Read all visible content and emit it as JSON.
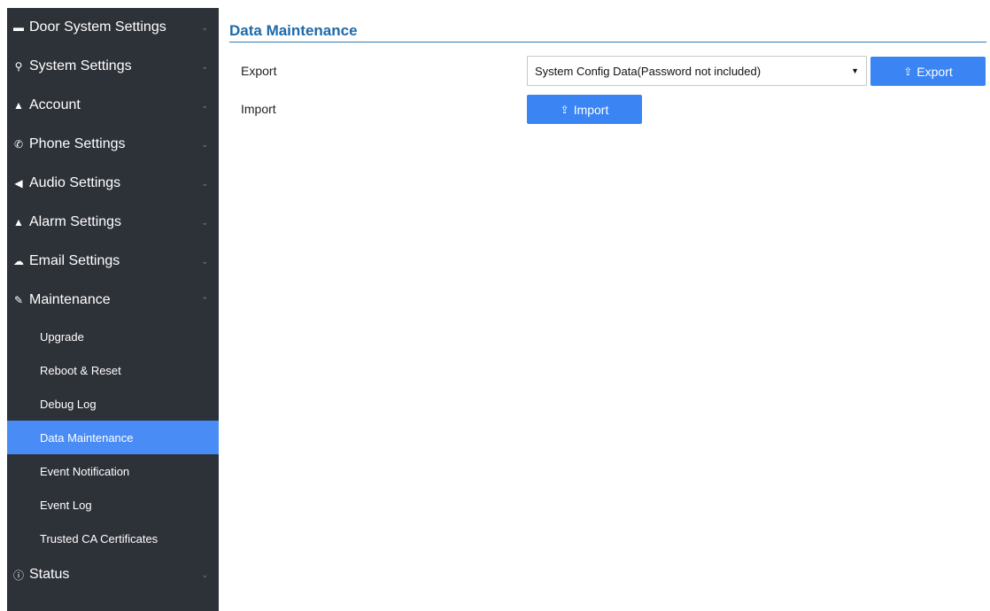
{
  "sidebar": {
    "items": [
      {
        "label": "Door System Settings",
        "icon": "card-icon",
        "glyph": "▬",
        "chevron": "⌄"
      },
      {
        "label": "System Settings",
        "icon": "key-icon",
        "glyph": "⚲",
        "chevron": "⌄"
      },
      {
        "label": "Account",
        "icon": "user-icon",
        "glyph": "▲",
        "chevron": "⌄"
      },
      {
        "label": "Phone Settings",
        "icon": "phone-icon",
        "glyph": "✆",
        "chevron": "⌄"
      },
      {
        "label": "Audio Settings",
        "icon": "speaker-icon",
        "glyph": "◀",
        "chevron": "⌄"
      },
      {
        "label": "Alarm Settings",
        "icon": "bell-icon",
        "glyph": "▲",
        "chevron": "⌄"
      },
      {
        "label": "Email Settings",
        "icon": "cloud-icon",
        "glyph": "☁",
        "chevron": "⌄"
      },
      {
        "label": "Maintenance",
        "icon": "wrench-icon",
        "glyph": "✎",
        "chevron": "⌃"
      }
    ],
    "maintenance_sub": [
      "Upgrade",
      "Reboot & Reset",
      "Debug Log",
      "Data Maintenance",
      "Event Notification",
      "Event Log",
      "Trusted CA Certificates"
    ],
    "status": {
      "label": "Status",
      "icon": "info-icon",
      "glyph": "ⓘ",
      "chevron": "⌄"
    }
  },
  "main": {
    "title": "Data Maintenance",
    "export_label": "Export",
    "import_label": "Import",
    "export_select_value": "System Config Data(Password not included)",
    "export_button": "Export",
    "import_button": "Import",
    "caret": "▼",
    "button_glyph": "⇪"
  },
  "colors": {
    "sidebar_bg": "#2d3138",
    "active_item": "#4a8cf6",
    "button": "#3a84f4",
    "title": "#1e6aa8"
  }
}
